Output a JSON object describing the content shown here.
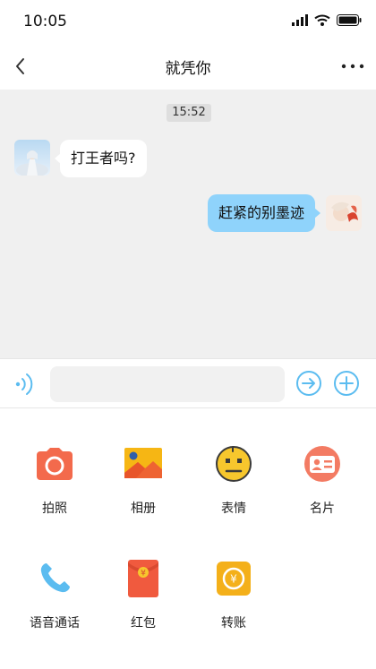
{
  "status_bar": {
    "time": "10:05"
  },
  "nav": {
    "title": "就凭你"
  },
  "chat": {
    "timestamp": "15:52",
    "messages": [
      {
        "direction": "incoming",
        "text": "打王者吗?"
      },
      {
        "direction": "outgoing",
        "text": "赶紧的别墨迹"
      }
    ]
  },
  "input": {
    "value": "",
    "placeholder": ""
  },
  "panel": {
    "items": [
      {
        "label": "拍照",
        "icon": "camera-icon"
      },
      {
        "label": "相册",
        "icon": "album-icon"
      },
      {
        "label": "表情",
        "icon": "emoji-icon"
      },
      {
        "label": "名片",
        "icon": "contact-card-icon"
      },
      {
        "label": "语音通话",
        "icon": "phone-icon"
      },
      {
        "label": "红包",
        "icon": "red-packet-icon"
      },
      {
        "label": "转账",
        "icon": "transfer-icon"
      }
    ]
  },
  "colors": {
    "accent": "#5bbcf0",
    "outgoing_bubble": "#8fd3fb",
    "chat_background": "#f0f0f0",
    "camera": "#f36a4c",
    "album": "#f6b614",
    "emoji": "#f7c72d",
    "contact_card": "#f37b63",
    "phone": "#5bbcf0",
    "red_packet": "#f05a3e",
    "transfer": "#f4b01a"
  }
}
